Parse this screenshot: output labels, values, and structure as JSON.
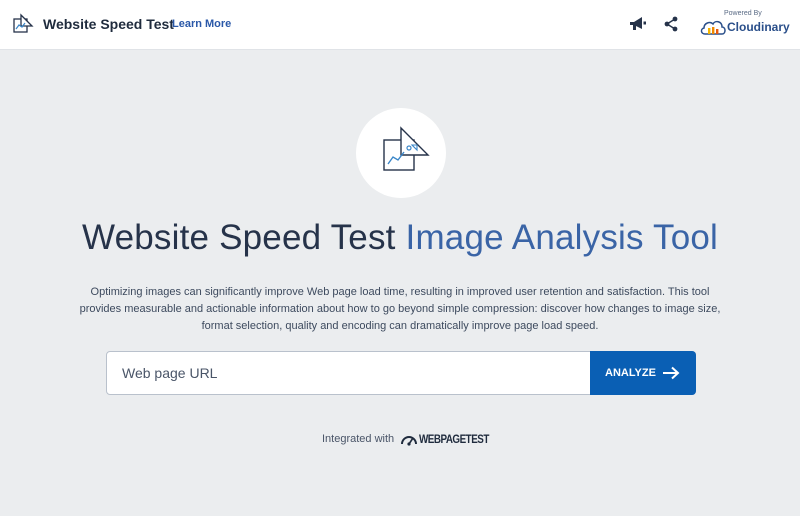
{
  "header": {
    "app_title": "Website Speed Test",
    "learn_more": "Learn More",
    "powered_by": "Powered By",
    "brand": "Cloudinary",
    "icons": [
      "speed-test-logo-icon",
      "megaphone-icon",
      "share-icon",
      "cloudinary-cloud-icon"
    ]
  },
  "hero": {
    "icon": "image-analysis-icon",
    "title_part1": "Website Speed Test",
    "title_part2": "Image Analysis Tool",
    "description": "Optimizing images can significantly improve Web page load time, resulting in improved user retention and satisfaction. This tool provides measurable and actionable information about how to go beyond simple compression: discover how changes to image size, format selection, quality and encoding can dramatically improve page load speed."
  },
  "search": {
    "placeholder": "Web page URL",
    "value": "",
    "button_label": "ANALYZE",
    "button_icon": "arrow-right-icon"
  },
  "footer": {
    "integrated_with": "Integrated with",
    "partner": "WEBPAGETEST",
    "partner_icon": "speedometer-icon"
  },
  "colors": {
    "background": "#ebedef",
    "header_bg": "#ffffff",
    "title_dark": "#26334a",
    "title_blue": "#3a64a6",
    "button": "#0a5fb4",
    "link": "#2a58a8"
  }
}
